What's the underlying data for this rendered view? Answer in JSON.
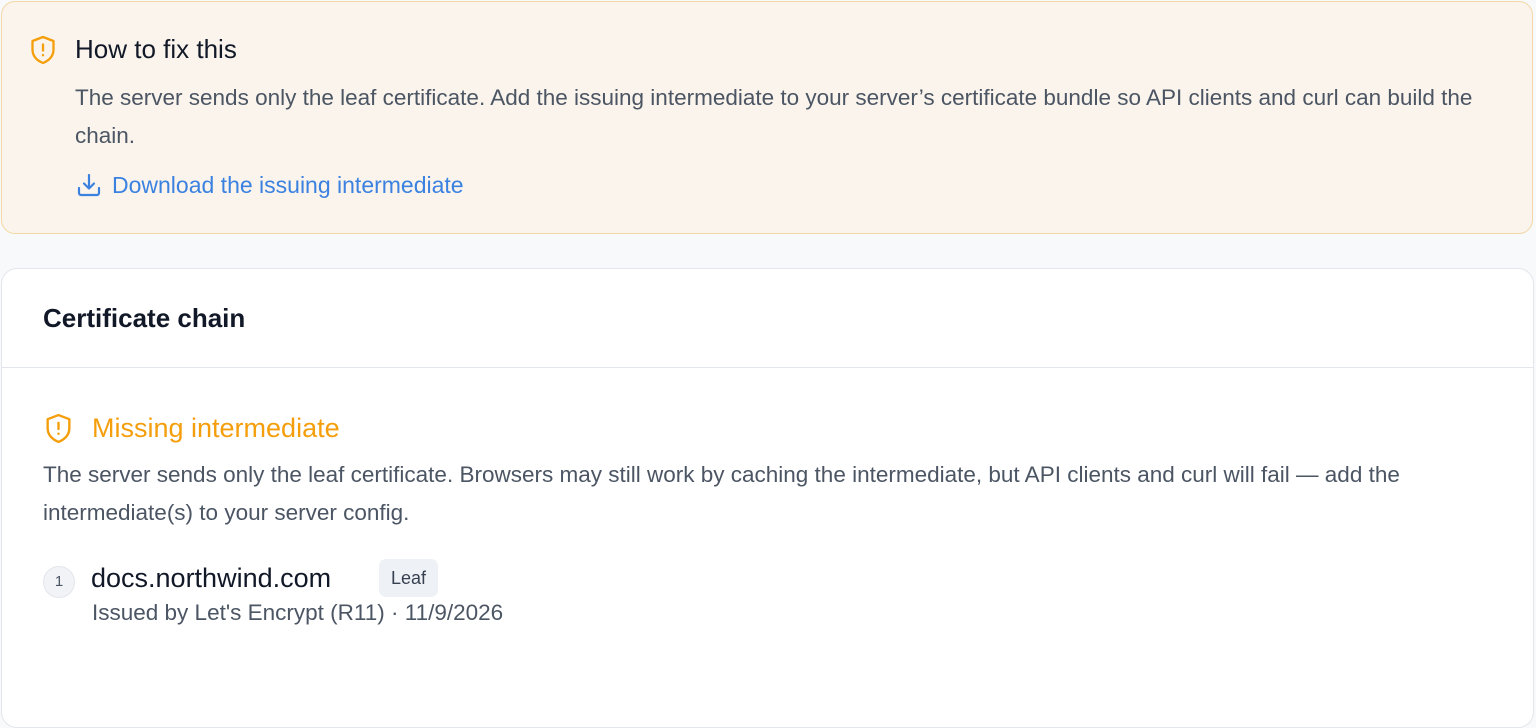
{
  "fix": {
    "title": "How to fix this",
    "body": "The server sends only the leaf certificate. Add the issuing intermediate to your server’s certificate bundle so API clients and curl can build the chain.",
    "link_label": "Download the issuing intermediate",
    "icon": "shield-alert-icon",
    "link_icon": "download-icon"
  },
  "chain": {
    "title": "Certificate chain",
    "warning": {
      "title": "Missing intermediate",
      "body": "The server sends only the leaf certificate. Browsers may still work by caching the intermediate, but API clients and curl will fail — add the intermediate(s) to your server config.",
      "icon": "shield-alert-icon"
    },
    "entries": [
      {
        "number": "1",
        "host": "docs.northwind.com",
        "badge": "Leaf",
        "meta": "Issued by Let's Encrypt (R11) · 11/9/2026"
      }
    ]
  },
  "colors": {
    "warning": "#f59e0b",
    "link": "#3b82e0",
    "fix_background": "#faf4ec",
    "fix_border": "#f3d7a4"
  }
}
